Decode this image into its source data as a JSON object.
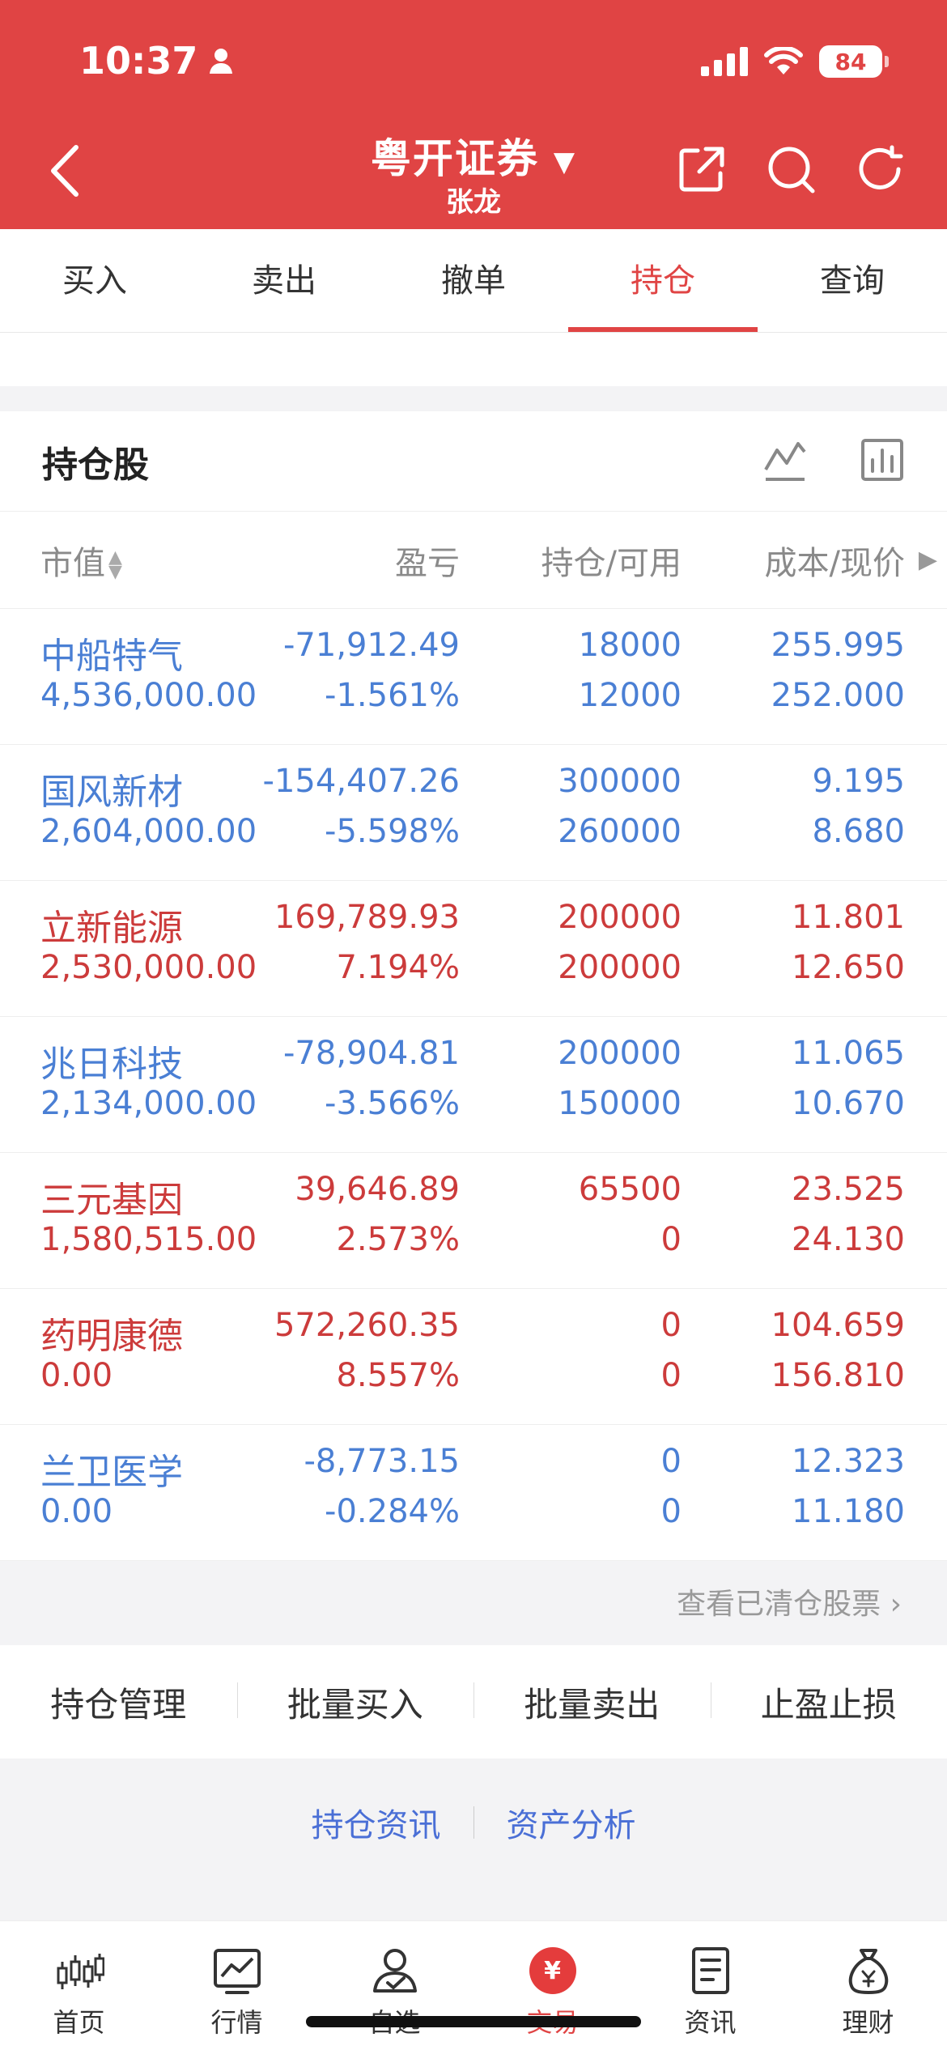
{
  "status": {
    "time": "10:37",
    "battery": "84"
  },
  "nav": {
    "title": "粤开证券",
    "subtitle": "张龙"
  },
  "tabs": [
    "买入",
    "卖出",
    "撤单",
    "持仓",
    "查询"
  ],
  "active_tab": 3,
  "holdings": {
    "title": "持仓股",
    "columns": {
      "c1": "市值",
      "c2": "盈亏",
      "c3": "持仓/可用",
      "c4": "成本/现价"
    },
    "rows": [
      {
        "name": "中船特气",
        "value": "4,536,000.00",
        "pnl": "-71,912.49",
        "pnl_pct": "-1.561%",
        "hold": "18000",
        "avail": "12000",
        "cost": "255.995",
        "price": "252.000",
        "trend": "down"
      },
      {
        "name": "国风新材",
        "value": "2,604,000.00",
        "pnl": "-154,407.26",
        "pnl_pct": "-5.598%",
        "hold": "300000",
        "avail": "260000",
        "cost": "9.195",
        "price": "8.680",
        "trend": "down"
      },
      {
        "name": "立新能源",
        "value": "2,530,000.00",
        "pnl": "169,789.93",
        "pnl_pct": "7.194%",
        "hold": "200000",
        "avail": "200000",
        "cost": "11.801",
        "price": "12.650",
        "trend": "up"
      },
      {
        "name": "兆日科技",
        "value": "2,134,000.00",
        "pnl": "-78,904.81",
        "pnl_pct": "-3.566%",
        "hold": "200000",
        "avail": "150000",
        "cost": "11.065",
        "price": "10.670",
        "trend": "down"
      },
      {
        "name": "三元基因",
        "value": "1,580,515.00",
        "pnl": "39,646.89",
        "pnl_pct": "2.573%",
        "hold": "65500",
        "avail": "0",
        "cost": "23.525",
        "price": "24.130",
        "trend": "up"
      },
      {
        "name": "药明康德",
        "value": "0.00",
        "pnl": "572,260.35",
        "pnl_pct": "8.557%",
        "hold": "0",
        "avail": "0",
        "cost": "104.659",
        "price": "156.810",
        "trend": "up"
      },
      {
        "name": "兰卫医学",
        "value": "0.00",
        "pnl": "-8,773.15",
        "pnl_pct": "-0.284%",
        "hold": "0",
        "avail": "0",
        "cost": "12.323",
        "price": "11.180",
        "trend": "down"
      }
    ]
  },
  "cleared_link": "查看已清仓股票",
  "actions": [
    "持仓管理",
    "批量买入",
    "批量卖出",
    "止盈止损"
  ],
  "links": [
    "持仓资讯",
    "资产分析"
  ],
  "bottom_tabs": [
    {
      "label": "首页",
      "icon": "candlestick-icon"
    },
    {
      "label": "行情",
      "icon": "market-chart-icon"
    },
    {
      "label": "自选",
      "icon": "user-check-icon"
    },
    {
      "label": "交易",
      "icon": "yuan-coin-icon"
    },
    {
      "label": "资讯",
      "icon": "news-icon"
    },
    {
      "label": "理财",
      "icon": "money-bag-icon"
    }
  ],
  "colors": {
    "brand_red": "#e04444",
    "gain": "#cc3b3b",
    "loss": "#4a7fd4",
    "link_blue": "#4a6fd6"
  }
}
